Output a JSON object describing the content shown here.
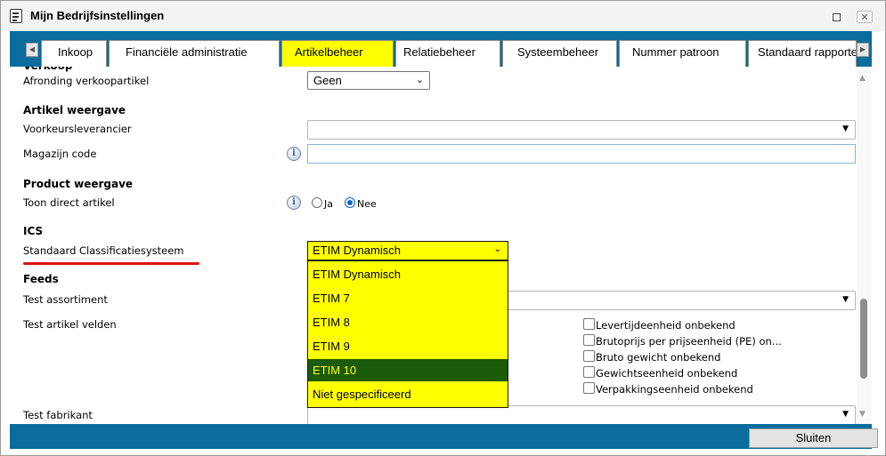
{
  "window": {
    "title": "Mijn Bedrijfsinstellingen",
    "icons": [
      "document-list-icon",
      "maximize-icon",
      "close-icon"
    ]
  },
  "tabs": [
    {
      "label": "Inkoop",
      "active": false
    },
    {
      "label": "Financiële administratie",
      "active": false
    },
    {
      "label": "Artikelbeheer",
      "active": true
    },
    {
      "label": "Relatiebeheer",
      "active": false
    },
    {
      "label": "Systeembeheer",
      "active": false
    },
    {
      "label": "Nummer patroon",
      "active": false
    },
    {
      "label": "Standaard rapporten",
      "active": false
    }
  ],
  "form": {
    "verkoop": {
      "afronding_label": "Afronding verkoopartikel",
      "afronding_value": "Geen"
    },
    "artikel_weergave": {
      "heading": "Artikel weergave",
      "voorkeur_label": "Voorkeursleverancier",
      "voorkeur_value": "",
      "magazijn_label": "Magazijn code",
      "magazijn_value": ""
    },
    "product_weergave": {
      "heading": "Product weergave",
      "toon_label": "Toon direct artikel",
      "option_ja": "Ja",
      "option_nee": "Nee",
      "selected": "Nee"
    },
    "ics": {
      "heading": "ICS",
      "classificatie_label": "Standaard Classificatiesysteem",
      "classificatie_value": "ETIM Dynamisch",
      "options": [
        "ETIM Dynamisch",
        "ETIM 7",
        "ETIM 8",
        "ETIM 9",
        "ETIM 10",
        "Niet gespecificeerd"
      ],
      "hovered": "ETIM 10"
    },
    "feeds": {
      "heading": "Feeds",
      "assortiment_label": "Test assortiment",
      "artikel_velden_label": "Test artikel velden",
      "checkboxes": [
        {
          "label": "Levertijdeenheid onbekend",
          "checked": false
        },
        {
          "label": "Brutoprijs per prijseenheid (PE) on...",
          "checked": false
        },
        {
          "label": "Bruto gewicht onbekend",
          "checked": false
        },
        {
          "label": "Gewichtseenheid onbekend",
          "checked": false
        },
        {
          "label": "Verpakkingseenheid onbekend",
          "checked": false
        }
      ],
      "fabrikant_label": "Test fabrikant"
    }
  },
  "footer": {
    "close_label": "Sluiten"
  },
  "colors": {
    "accent": "#0a6d9e",
    "highlight": "#ffff00",
    "selected": "#1c5b0a",
    "underline": "#e01010"
  }
}
